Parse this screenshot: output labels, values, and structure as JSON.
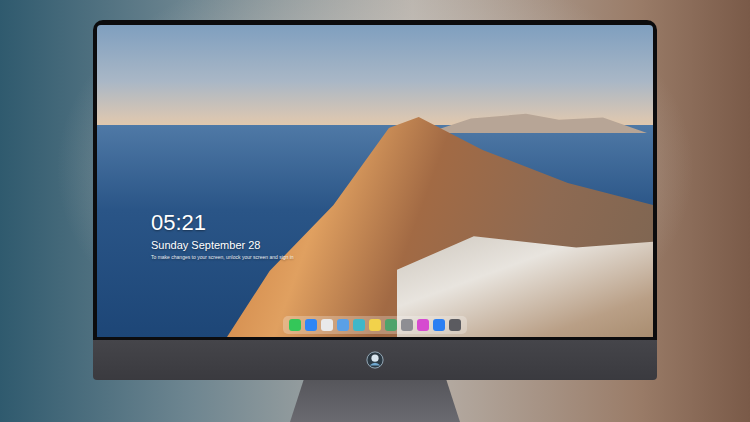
{
  "lock_screen": {
    "time": "05:21",
    "date": "Sunday September 28",
    "message": "To make changes to your screen, unlock your screen and sign in"
  },
  "dock": {
    "apps": [
      {
        "color": "#34c759"
      },
      {
        "color": "#2f86f5"
      },
      {
        "color": "#e9e9ea"
      },
      {
        "color": "#5aa0e6"
      },
      {
        "color": "#3fb7c9"
      },
      {
        "color": "#f2d24b"
      },
      {
        "color": "#4fa36b"
      },
      {
        "color": "#8e8e93"
      },
      {
        "color": "#d64bd0"
      },
      {
        "color": "#2b7ff3"
      },
      {
        "color": "#5b5b60"
      }
    ]
  }
}
